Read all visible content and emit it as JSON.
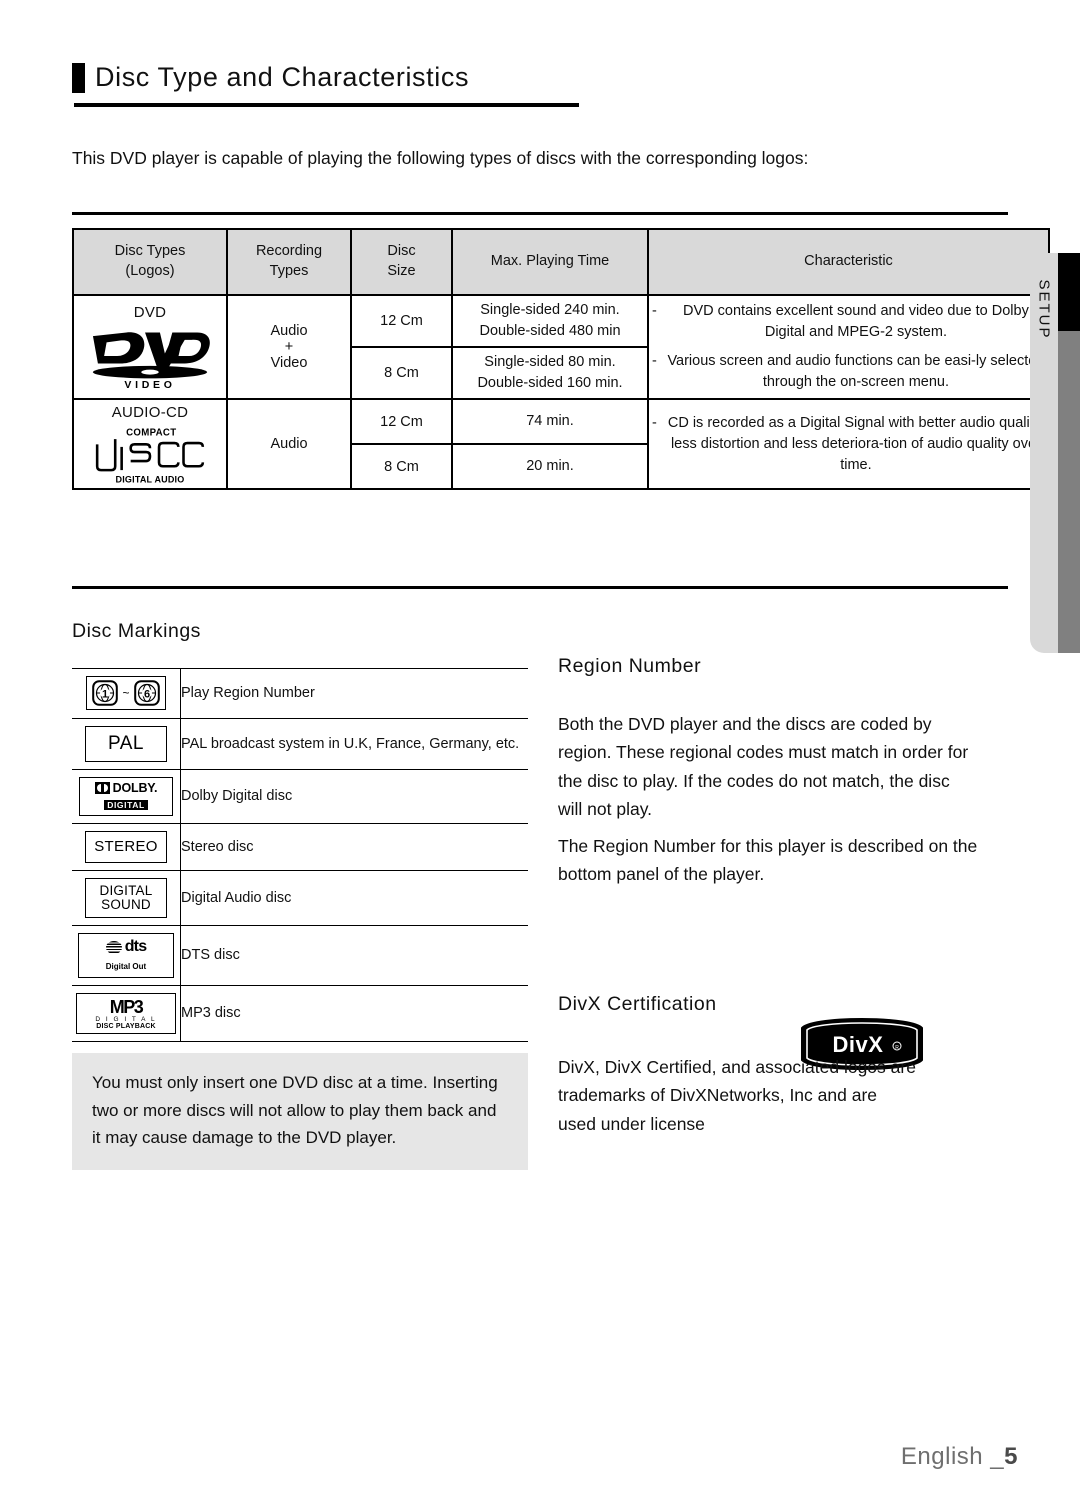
{
  "page": {
    "title": "Disc Type and Characteristics",
    "intro": "This DVD player is capable of playing the following types of discs with the corresponding logos:",
    "side_tab_label": "SETUP",
    "footer_language": "English _",
    "footer_page": "5"
  },
  "disc_table": {
    "headers": {
      "disc_types": "Disc Types\n(Logos)",
      "disc_types_line1": "Disc Types",
      "disc_types_line2": "(Logos)",
      "recording_line1": "Recording",
      "recording_line2": "Types",
      "size_line1": "Disc",
      "size_line2": "Size",
      "max_time": "Max. Playing Time",
      "characteristic": "Characteristic"
    },
    "rows": [
      {
        "logo_caption": "DVD",
        "logo_name": "dvd-video-logo",
        "logo_sub": "V I D E O",
        "recording": "Audio\n+\nVideo",
        "recording_l1": "Audio",
        "recording_l2": "+",
        "recording_l3": "Video",
        "sizes": [
          {
            "size": "12 Cm",
            "time_l1": "Single-sided 240 min.",
            "time_l2": "Double-sided 480 min"
          },
          {
            "size": "8 Cm",
            "time_l1": "Single-sided 80 min.",
            "time_l2": "Double-sided 160 min."
          }
        ],
        "characteristics": [
          "DVD contains excellent sound and video due to Dolby Digital and MPEG-2 system.",
          "Various screen and audio functions can be easi-ly selected through the on-screen menu."
        ]
      },
      {
        "logo_caption": "AUDIO-CD",
        "logo_name": "compact-disc-digital-audio-logo",
        "logo_top": "COMPACT",
        "logo_mid": "disc",
        "logo_bottom": "DIGITAL AUDIO",
        "recording_l1": "Audio",
        "sizes": [
          {
            "size": "12 Cm",
            "time_l1": "74 min.",
            "time_l2": ""
          },
          {
            "size": "8 Cm",
            "time_l1": "20 min.",
            "time_l2": ""
          }
        ],
        "characteristics": [
          "CD is recorded as a Digital Signal with better audio quality, less distortion and less deteriora-tion of audio quality over time."
        ]
      }
    ]
  },
  "disc_markings": {
    "heading": "Disc Markings",
    "rows": [
      {
        "icon": "region-number-badges",
        "region_from": "1",
        "region_to": "6",
        "tilde": "~",
        "desc": "Play Region Number"
      },
      {
        "icon": "pal-badge",
        "label": "PAL",
        "desc": "PAL broadcast system in U.K, France, Germany, etc."
      },
      {
        "icon": "dolby-digital-badge",
        "label_main": "DOLBY.",
        "label_sub": "DIGITAL",
        "desc": "Dolby Digital disc"
      },
      {
        "icon": "stereo-badge",
        "label": "STEREO",
        "desc": "Stereo disc"
      },
      {
        "icon": "digital-sound-badge",
        "label_l1": "DIGITAL",
        "label_l2": "SOUND",
        "desc": "Digital Audio disc"
      },
      {
        "icon": "dts-badge",
        "label_main": "dts",
        "label_sub": "Digital Out",
        "desc": "DTS disc"
      },
      {
        "icon": "mp3-badge",
        "label_main": "MP3",
        "label_sub1": "D I G I T A L",
        "label_sub2": "DISC PLAYBACK",
        "desc": "MP3 disc"
      }
    ]
  },
  "note": {
    "text": "You must only insert one DVD disc at a time. Inserting two or more discs will not allow to play them back and it may cause damage to the DVD player."
  },
  "region_number": {
    "heading": "Region Number",
    "paragraph_1": "Both the DVD player and the discs are coded by region. These regional codes must match in order for the disc to play. If the codes do not match, the disc will not play.",
    "paragraph_2": "The Region Number for this player is described on the bottom panel of the player."
  },
  "divx": {
    "heading": "DivX Certification",
    "logo_text": "DivX",
    "paragraph": "DivX, DivX Certified, and associated logos are trademarks of DivXNetworks, Inc and are used under license"
  },
  "colors": {
    "header_fill": "#d9d9d9",
    "note_fill": "#e6e6e6",
    "tab_fill": "#d9d9d9",
    "tab_edge_black": "#000000",
    "tab_edge_gray": "#808080",
    "footer_text": "#6f6f6f"
  }
}
